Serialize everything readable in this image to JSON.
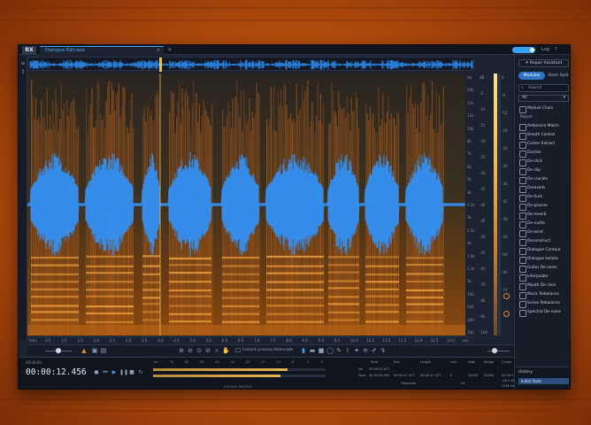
{
  "app": {
    "logo": "RX",
    "tab_title": "Dialogue Edit.wav",
    "tab_close": "×",
    "tab_add": "+",
    "titlebar_buttons": [
      "Log",
      "?"
    ]
  },
  "colors": {
    "accent": "#3aa0ff",
    "spectrogram_warm": "#e6892c",
    "waveform": "#2f95ff",
    "background": "#1b2230",
    "desktop": "#c8561a"
  },
  "spectrogram": {
    "frequency_labels": [
      "Hz",
      "20k",
      "15k",
      "12k",
      "10k",
      "8k",
      "7k",
      "6k",
      "5k",
      "4k",
      "3.5k",
      "3k",
      "2.5k",
      "2k",
      "1.5k",
      "1.2k",
      "1k",
      "700",
      "500",
      "300",
      "100"
    ],
    "db_labels": [
      "dB",
      "-5",
      "-10",
      "-15",
      "-20",
      "-25",
      "-30",
      "-35",
      "-40",
      "-45",
      "-50",
      "-55",
      "-60",
      "-70",
      "-80",
      "-90",
      "-100"
    ],
    "meter_labels": [
      "0",
      "-6",
      "-12",
      "-18",
      "-24",
      "-30",
      "-36",
      "-42",
      "-48",
      "-54",
      "-60",
      "-66",
      "-72"
    ],
    "time_labels": [
      "hms",
      "0.5",
      "1.0",
      "1.5",
      "2.0",
      "2.5",
      "3.0",
      "3.5",
      "4.0",
      "4.5",
      "5.0",
      "5.5",
      "6.0",
      "6.5",
      "7.0",
      "7.5",
      "8.0",
      "8.5",
      "9.0",
      "9.5",
      "10.0",
      "10.5",
      "11.0",
      "11.5",
      "12.0",
      "12.5",
      "13.0",
      "sec"
    ]
  },
  "toolbar": {
    "instant_process": "Instant process",
    "attenuate": "Attenuate"
  },
  "transport": {
    "time_label": "00:00:00",
    "timecode": "00:00:12.456",
    "level_ticks": [
      "-Inf",
      "-70",
      "-60",
      "-50",
      "-40",
      "-30",
      "-20",
      "-15",
      "-10",
      "-6",
      "-3",
      "0"
    ],
    "level_caption": "STEREO MATRIX",
    "level_L": 0.78,
    "level_R": 0.74
  },
  "selection": {
    "headers": [
      "Start",
      "End",
      "Length",
      "Low",
      "High",
      "Range",
      "Cursor"
    ],
    "sel_row_label": "Sel",
    "view_row_label": "View",
    "sel_values": [
      "00:00:04.877",
      "",
      "",
      "",
      "",
      "",
      ""
    ],
    "view_values": [
      "00:00:00.000",
      "00:00:47.477",
      "00:00:47.477",
      "0",
      "22050",
      "22050",
      "00:00:17.87 s"
    ],
    "extra": [
      "-26.1 dB",
      "1764 Hz"
    ],
    "timecode_label": "Timecode",
    "hz_label": "Hz"
  },
  "rightpanel": {
    "repair_assistant": "Repair Assistant",
    "modules_tab": "Modules",
    "stemsplit_tab": "Stem Split",
    "search_placeholder": "Search",
    "filter_value": "All",
    "modules": [
      {
        "label": "Module Chain",
        "section": false
      },
      {
        "label": "Repair",
        "section": true
      },
      {
        "label": "Ambience Match",
        "section": false
      },
      {
        "label": "Breath Control",
        "section": false
      },
      {
        "label": "Center Extract",
        "section": false
      },
      {
        "label": "Declick",
        "section": false
      },
      {
        "label": "De-click",
        "section": false
      },
      {
        "label": "De-clip",
        "section": false
      },
      {
        "label": "De-crackle",
        "section": false
      },
      {
        "label": "Dereverb",
        "section": false
      },
      {
        "label": "De-hum",
        "section": false
      },
      {
        "label": "De-plosive",
        "section": false
      },
      {
        "label": "De-reverb",
        "section": false
      },
      {
        "label": "De-rustle",
        "section": false
      },
      {
        "label": "De-wind",
        "section": false
      },
      {
        "label": "Deconstruct",
        "section": false
      },
      {
        "label": "Dialogue Contour",
        "section": false
      },
      {
        "label": "Dialogue Isolate",
        "section": false
      },
      {
        "label": "Guitar De-noise",
        "section": false
      },
      {
        "label": "Interpolate",
        "section": false
      },
      {
        "label": "Mouth De-click",
        "section": false
      },
      {
        "label": "Music Rebalance",
        "section": false
      },
      {
        "label": "Scene Rebalance",
        "section": false
      },
      {
        "label": "Spectral De-noise",
        "section": false
      }
    ],
    "history_title": "History",
    "history_item": "Initial State"
  }
}
